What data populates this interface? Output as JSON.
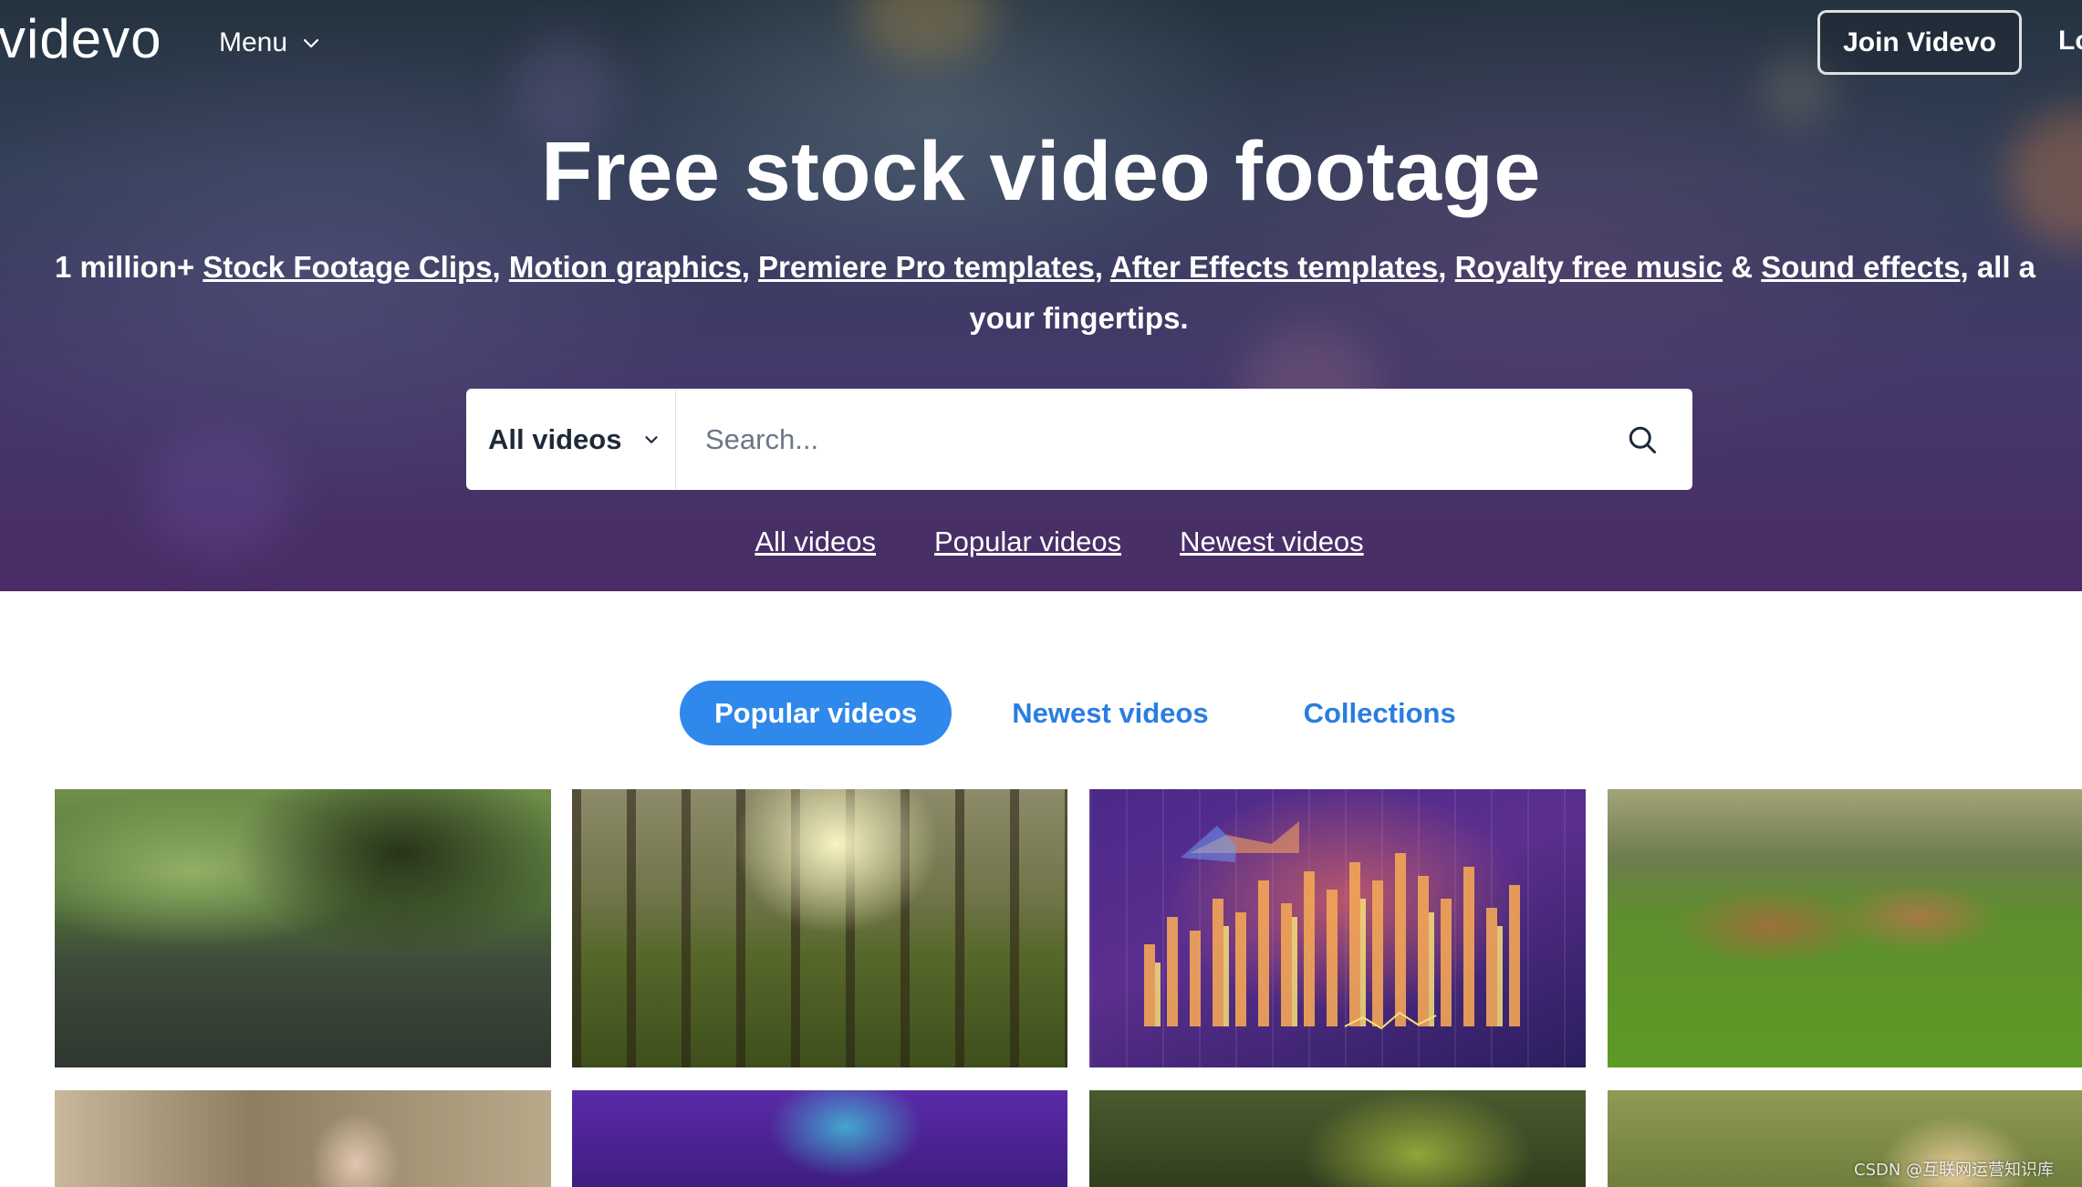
{
  "header": {
    "logo_text": "videvo",
    "menu_label": "Menu",
    "join_label": "Join Videvo",
    "login_label": "Lo"
  },
  "hero": {
    "title": "Free stock video footage",
    "subtitle_prefix": "1 million+ ",
    "links": [
      "Stock Footage Clips",
      "Motion graphics",
      "Premiere Pro templates",
      "After Effects templates",
      "Royalty free music",
      "Sound effects"
    ],
    "amp": " & ",
    "subtitle_suffix": ", all a",
    "subtitle_line2": "your fingertips."
  },
  "search": {
    "category": "All videos",
    "placeholder": "Search..."
  },
  "quick_links": [
    "All videos",
    "Popular videos",
    "Newest videos"
  ],
  "tabs": [
    "Popular videos",
    "Newest videos",
    "Collections"
  ],
  "active_tab": "Popular videos",
  "colors": {
    "accent": "#2f88eb",
    "accent_text": "#2a7de1"
  },
  "watermark": "CSDN @互联网运营知识库"
}
